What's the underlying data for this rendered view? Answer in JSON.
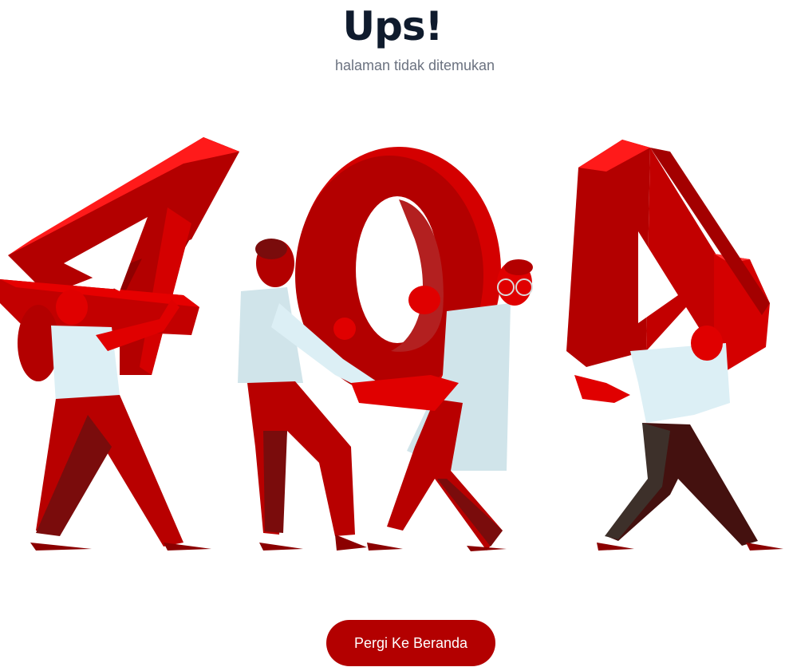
{
  "header": {
    "title": "Ups!",
    "subtitle": "halaman tidak ditemukan"
  },
  "illustration": {
    "text": "404",
    "icon": "people-carrying-404-illustration",
    "colors": {
      "digit_front": "#b30000",
      "digit_top": "#ff0000",
      "digit_side": "#e00000",
      "skin": "#e00000",
      "shirt": "#dceff5",
      "pants": "#b80000",
      "pants_dark": "#7a0c0c"
    }
  },
  "actions": {
    "home_label": "Pergi Ke Beranda"
  },
  "theme": {
    "accent": "#b30000",
    "title_color": "#0f1b2d",
    "subtitle_color": "#6b7280",
    "background": "#ffffff"
  }
}
